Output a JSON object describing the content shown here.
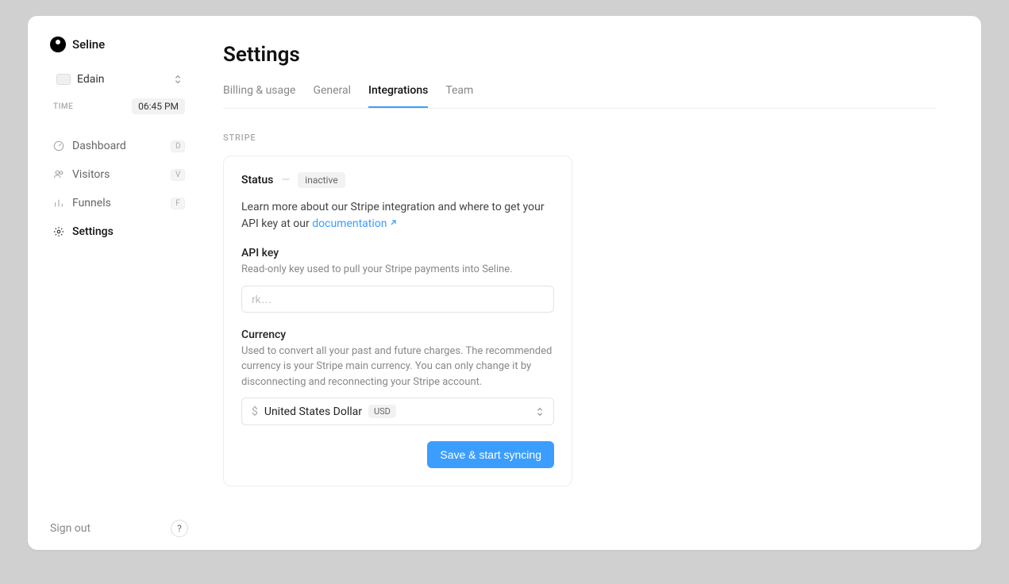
{
  "brand": {
    "name": "Seline"
  },
  "workspace": {
    "name": "Edain"
  },
  "time": {
    "label": "TIME",
    "value": "06:45 PM"
  },
  "nav": {
    "items": [
      {
        "label": "Dashboard",
        "kbd": "D"
      },
      {
        "label": "Visitors",
        "kbd": "V"
      },
      {
        "label": "Funnels",
        "kbd": "F"
      },
      {
        "label": "Settings",
        "kbd": ""
      }
    ]
  },
  "footer": {
    "signout": "Sign out",
    "help": "?"
  },
  "page": {
    "title": "Settings"
  },
  "tabs": {
    "items": [
      {
        "label": "Billing & usage"
      },
      {
        "label": "General"
      },
      {
        "label": "Integrations"
      },
      {
        "label": "Team"
      }
    ]
  },
  "stripe": {
    "section": "STRIPE",
    "status_label": "Status",
    "status_value": "inactive",
    "learn_prefix": "Learn more about our Stripe integration and where to get your API key at our ",
    "docs_label": "documentation",
    "api": {
      "label": "API key",
      "desc": "Read-only key used to pull your Stripe payments into Seline.",
      "placeholder": "rk…"
    },
    "currency": {
      "label": "Currency",
      "desc": "Used to convert all your past and future charges. The recommended currency is your Stripe main currency. You can only change it by disconnecting and reconnecting your Stripe account.",
      "selected_name": "United States Dollar",
      "selected_code": "USD"
    },
    "save_label": "Save & start syncing"
  }
}
